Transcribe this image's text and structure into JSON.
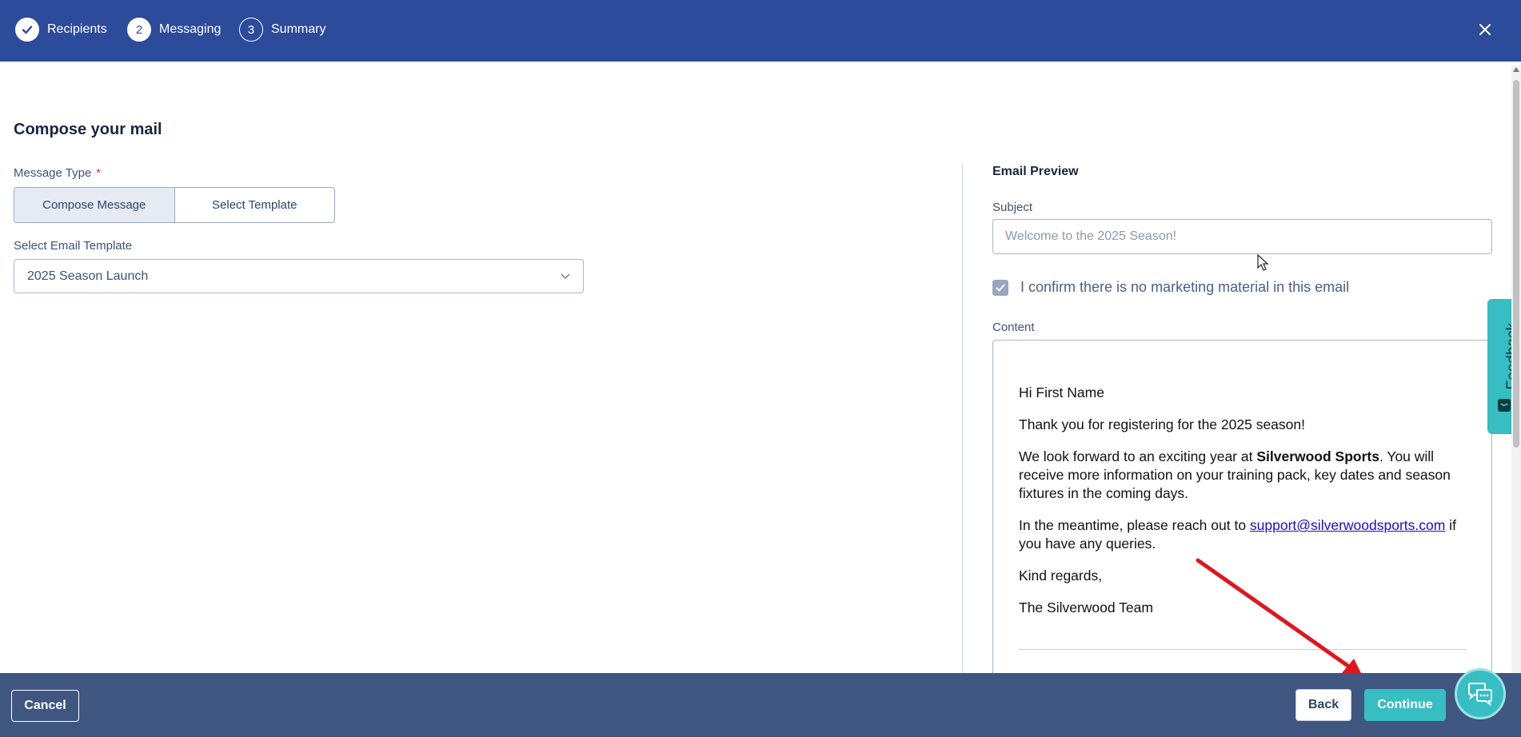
{
  "stepper": {
    "steps": [
      {
        "number": "",
        "label": "Recipients",
        "state": "done"
      },
      {
        "number": "2",
        "label": "Messaging",
        "state": "active"
      },
      {
        "number": "3",
        "label": "Summary",
        "state": "todo"
      }
    ],
    "close_icon": "close-icon"
  },
  "compose": {
    "title": "Compose your mail",
    "message_type_label": "Message Type",
    "required_marker": "*",
    "options": [
      "Compose Message",
      "Select Template"
    ],
    "selected_option": "Compose Message",
    "template_label": "Select Email Template",
    "template_value": "2025 Season Launch"
  },
  "preview": {
    "title": "Email Preview",
    "subject_label": "Subject",
    "subject_placeholder": "Welcome to the 2025 Season!",
    "confirm_text": "I confirm there is no marketing material in this email",
    "confirm_checked": true,
    "content_label": "Content",
    "email": {
      "greeting": "Hi First Name",
      "line1": "Thank you for registering for the 2025 season!",
      "line2_pre": "We look forward to an exciting year at ",
      "line2_bold": "Silverwood Sports",
      "line2_post": ". You will receive more information on your training pack, key dates and season fixtures in the coming days.",
      "line3_pre": "In the meantime, please reach out to ",
      "line3_link": "support@silverwoodsports.com",
      "line3_post": " if you have any queries.",
      "signoff": "Kind regards,",
      "signature": "The Silverwood Team"
    }
  },
  "feedback": {
    "label": "Feedback"
  },
  "footer": {
    "cancel": "Cancel",
    "back": "Back",
    "continue": "Continue"
  },
  "colors": {
    "header": "#2d4b9b",
    "footer": "#3f5680",
    "accent": "#36bec2",
    "annotation_arrow": "#e0161e"
  }
}
